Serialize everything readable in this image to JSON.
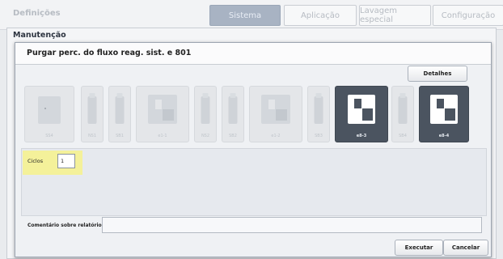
{
  "app": {
    "section_title": "Definições"
  },
  "tabs": [
    {
      "label": "Sistema",
      "active": true
    },
    {
      "label": "Aplicação",
      "active": false
    },
    {
      "label": "Lavagem especial",
      "active": false
    },
    {
      "label": "Configuração",
      "active": false
    }
  ],
  "maintenance": {
    "title": "Manutenção"
  },
  "dialog": {
    "title": "Purgar perc. do fluxo reag. sist. e 801",
    "details_button": "Detalhes",
    "cycles_label": "Ciclos",
    "cycles_value": "1",
    "comment_label": "Comentário sobre relatório",
    "comment_value": "",
    "execute_button": "Executar",
    "cancel_button": "Cancelar"
  },
  "reagents": [
    {
      "label": "SS4",
      "kind": "pack",
      "selected": false
    },
    {
      "label": "NS1",
      "kind": "bottle",
      "selected": false
    },
    {
      "label": "SB1",
      "kind": "bottle",
      "selected": false
    },
    {
      "label": "e1-1",
      "kind": "rack",
      "selected": false
    },
    {
      "label": "NS2",
      "kind": "bottle",
      "selected": false
    },
    {
      "label": "SB2",
      "kind": "bottle",
      "selected": false
    },
    {
      "label": "e1-2",
      "kind": "rack",
      "selected": false
    },
    {
      "label": "SB3",
      "kind": "bottle",
      "selected": false
    },
    {
      "label": "e8-3",
      "kind": "rack",
      "selected": true
    },
    {
      "label": "SB4",
      "kind": "bottle",
      "selected": false
    },
    {
      "label": "e8-4",
      "kind": "rack",
      "selected": true
    }
  ],
  "colors": {
    "selected_slot": "#4b5460",
    "cycles_highlight": "#f4f19a",
    "active_tab": "#a8b3c3"
  }
}
